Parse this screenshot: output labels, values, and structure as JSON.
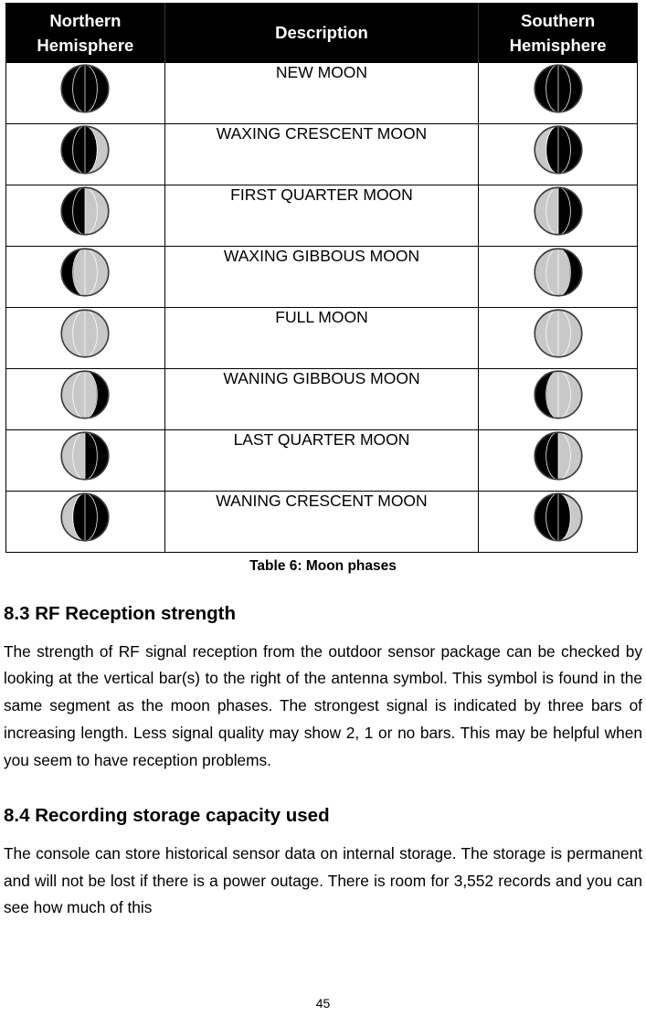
{
  "table": {
    "headers": [
      "Northern Hemisphere",
      "Description",
      "Southern Hemisphere"
    ],
    "caption": "Table 6: Moon phases",
    "rows": [
      {
        "description": "NEW MOON",
        "phase": "new-moon",
        "lit_fraction": 0.0,
        "north_lit_side": "none"
      },
      {
        "description": "WAXING CRESCENT MOON",
        "phase": "waxing-crescent-moon",
        "lit_fraction": 0.25,
        "north_lit_side": "right"
      },
      {
        "description": "FIRST QUARTER MOON",
        "phase": "first-quarter-moon",
        "lit_fraction": 0.5,
        "north_lit_side": "right"
      },
      {
        "description": "WAXING GIBBOUS MOON",
        "phase": "waxing-gibbous-moon",
        "lit_fraction": 0.75,
        "north_lit_side": "right"
      },
      {
        "description": "FULL MOON",
        "phase": "full-moon",
        "lit_fraction": 1.0,
        "north_lit_side": "all"
      },
      {
        "description": "WANING GIBBOUS MOON",
        "phase": "waning-gibbous-moon",
        "lit_fraction": 0.75,
        "north_lit_side": "left"
      },
      {
        "description": "LAST QUARTER MOON",
        "phase": "last-quarter-moon",
        "lit_fraction": 0.5,
        "north_lit_side": "left"
      },
      {
        "description": "WANING CRESCENT MOON",
        "phase": "waning-crescent-moon",
        "lit_fraction": 0.25,
        "north_lit_side": "left"
      }
    ]
  },
  "sections": [
    {
      "heading": "8.3 RF Reception strength",
      "paragraph": "The strength of RF signal reception from the outdoor sensor package can be checked by looking at the vertical bar(s) to the right of the antenna symbol. This symbol is found in the same segment as the moon phases. The strongest signal is indicated by three bars of increasing length. Less signal quality may show 2, 1 or no bars. This may be helpful when you seem to have reception problems."
    },
    {
      "heading": "8.4 Recording storage capacity used",
      "paragraph": "The console can store historical sensor data on internal storage. The storage is permanent and will not be lost if there is a power outage. There is room for 3,552 records and you can see how much of this"
    }
  ],
  "page_number": "45",
  "colors": {
    "header_background": "#000000",
    "header_text": "#ffffff",
    "moon_lit": "#c8c8c8",
    "moon_dark": "#000000",
    "moon_outline": "#3c3c3c",
    "meridian": "#ffffff",
    "page_background": "#ffffff",
    "body_text": "#000000"
  }
}
